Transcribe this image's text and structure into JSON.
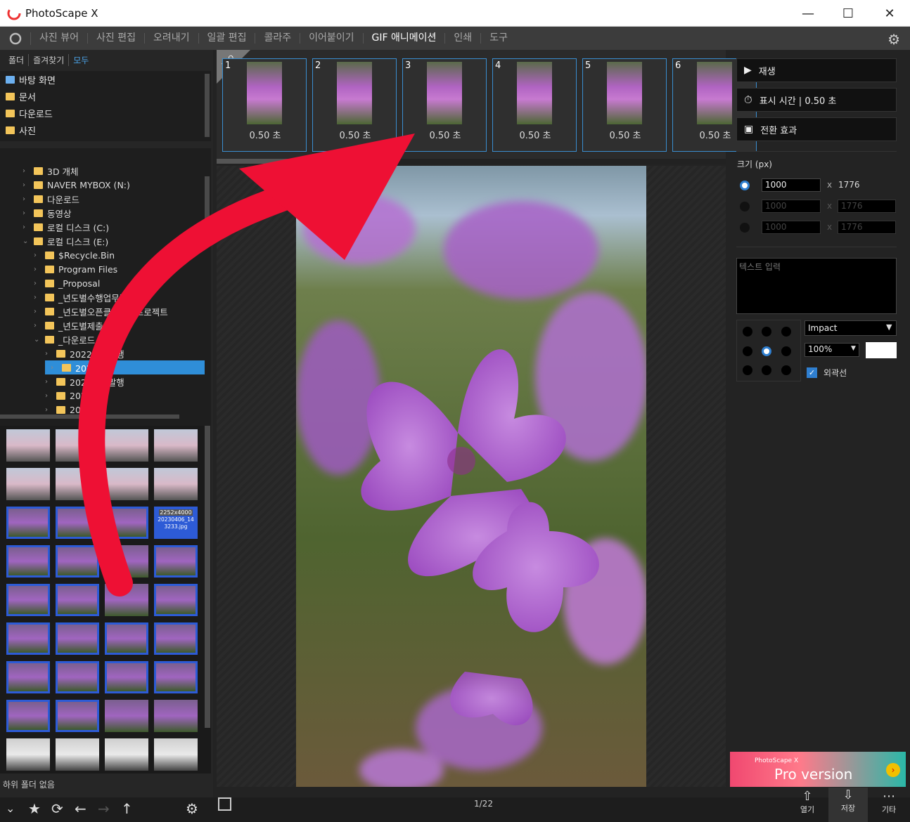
{
  "window": {
    "title": "PhotoScape X",
    "minimize": "—",
    "maximize": "☐",
    "close": "✕"
  },
  "menu": {
    "items": [
      "사진 뷰어",
      "사진 편집",
      "오려내기",
      "일괄 편집",
      "콜라주",
      "이어붙이기",
      "GIF 애니메이션",
      "인쇄",
      "도구"
    ],
    "active": "GIF 애니메이션"
  },
  "left": {
    "tabs": [
      "폴더",
      "즐겨찾기",
      "모두"
    ],
    "active_tab": "모두",
    "favorites": [
      "바탕 화면",
      "문서",
      "다운로드",
      "사진"
    ],
    "tree": [
      {
        "label": "3D 개체",
        "depth": 1
      },
      {
        "label": "NAVER MYBOX (N:)",
        "depth": 1
      },
      {
        "label": "다운로드",
        "depth": 1
      },
      {
        "label": "동영상",
        "depth": 1
      },
      {
        "label": "로컬 디스크 (C:)",
        "depth": 1
      },
      {
        "label": "로컬 디스크 (E:)",
        "depth": 1
      },
      {
        "label": "$Recycle.Bin",
        "depth": 2
      },
      {
        "label": "Program Files",
        "depth": 2
      },
      {
        "label": "_Proposal",
        "depth": 2
      },
      {
        "label": "_년도별수행업무및문서",
        "depth": 2
      },
      {
        "label": "_년도별오픈클릭수행프로젝트",
        "depth": 2
      },
      {
        "label": "_년도별제출서류",
        "depth": 2
      },
      {
        "label": "_다운로드",
        "depth": 2
      },
      {
        "label": "2022년미발행",
        "depth": 3
      },
      {
        "label": "2023꽃",
        "depth": 3,
        "selected": true
      },
      {
        "label": "2023년미발행",
        "depth": 3
      },
      {
        "label": "202209",
        "depth": 3
      },
      {
        "label": "202210",
        "depth": 3
      }
    ],
    "thumb_info": {
      "size": "2252x4000",
      "file": "20230406_143233.jpg"
    },
    "status": "하위 폴더 없음"
  },
  "strip": {
    "badge": "PRO",
    "frames": [
      {
        "num": "1",
        "dur": "0.50 초"
      },
      {
        "num": "2",
        "dur": "0.50 초"
      },
      {
        "num": "3",
        "dur": "0.50 초"
      },
      {
        "num": "4",
        "dur": "0.50 초"
      },
      {
        "num": "5",
        "dur": "0.50 초"
      },
      {
        "num": "6",
        "dur": "0.50 초"
      }
    ]
  },
  "right": {
    "play": "재생",
    "display_time": "표시 시간 | 0.50 초",
    "transition": "전환 효과",
    "size_label": "크기 (px)",
    "width": "1000",
    "height": "1776",
    "times": "x",
    "width_2": "1000",
    "height_2": "1776",
    "width_3": "1000",
    "height_3": "1776",
    "text_placeholder": "텍스트 입력",
    "font": "Impact",
    "zoom": "100%",
    "outline": "외곽선",
    "ad_title": "PhotoScape X",
    "ad_sub": "Pro version"
  },
  "bottom": {
    "page": "1/22",
    "open": "열기",
    "save": "저장",
    "more": "기타"
  },
  "colors": {
    "accent": "#2f8ed8",
    "frame_border": "#3a8ed0",
    "arrow": "#ee1034"
  }
}
